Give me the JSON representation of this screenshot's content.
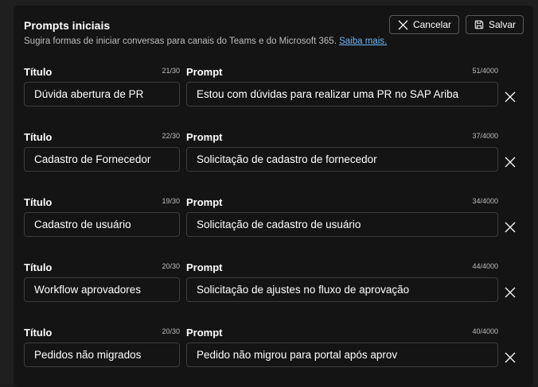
{
  "header": {
    "title": "Prompts iniciais",
    "description": "Sugira formas de iniciar conversas para canais do Teams e do Microsoft 365.",
    "link": "Saiba mais.",
    "cancel_label": "Cancelar",
    "save_label": "Salvar"
  },
  "labels": {
    "title": "Título",
    "prompt": "Prompt"
  },
  "prompts": [
    {
      "title": "Dúvida abertura de PR",
      "title_count": "21/30",
      "prompt": "Estou com dúvidas para realizar uma PR no SAP Ariba",
      "prompt_count": "51/4000"
    },
    {
      "title": "Cadastro de Fornecedor",
      "title_count": "22/30",
      "prompt": "Solicitação de cadastro de fornecedor",
      "prompt_count": "37/4000"
    },
    {
      "title": "Cadastro de usuário",
      "title_count": "19/30",
      "prompt": "Solicitação de cadastro de usuário",
      "prompt_count": "34/4000"
    },
    {
      "title": "Workflow aprovadores",
      "title_count": "20/30",
      "prompt": "Solicitação de ajustes no fluxo de aprovação",
      "prompt_count": "44/4000"
    },
    {
      "title": "Pedidos não migrados",
      "title_count": "20/30",
      "prompt": "Pedido não migrou para portal após aprov",
      "prompt_count": "40/4000"
    }
  ],
  "icons": {
    "cancel": "close-icon",
    "save": "save-icon",
    "remove": "close-icon"
  }
}
